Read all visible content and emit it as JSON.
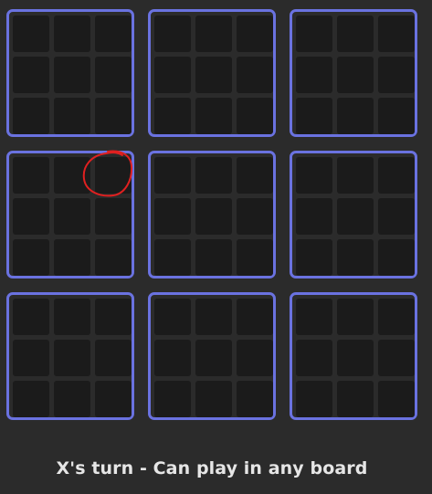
{
  "status_text": "X's turn - Can play in any board",
  "colors": {
    "board_border": "#6a72e0",
    "cell_bg": "#1b1b1b",
    "page_bg": "#2b2b2b",
    "annotation": "#e02020"
  },
  "boards": [
    {
      "cells": [
        "",
        "",
        "",
        "",
        "",
        "",
        "",
        "",
        ""
      ]
    },
    {
      "cells": [
        "",
        "",
        "",
        "",
        "",
        "",
        "",
        "",
        ""
      ]
    },
    {
      "cells": [
        "",
        "",
        "",
        "",
        "",
        "",
        "",
        "",
        ""
      ]
    },
    {
      "cells": [
        "",
        "",
        "",
        "",
        "",
        "",
        "",
        "",
        ""
      ]
    },
    {
      "cells": [
        "",
        "",
        "",
        "",
        "",
        "",
        "",
        "",
        ""
      ]
    },
    {
      "cells": [
        "",
        "",
        "",
        "",
        "",
        "",
        "",
        "",
        ""
      ]
    },
    {
      "cells": [
        "",
        "",
        "",
        "",
        "",
        "",
        "",
        "",
        ""
      ]
    },
    {
      "cells": [
        "",
        "",
        "",
        "",
        "",
        "",
        "",
        "",
        ""
      ]
    },
    {
      "cells": [
        "",
        "",
        "",
        "",
        "",
        "",
        "",
        "",
        ""
      ]
    }
  ]
}
